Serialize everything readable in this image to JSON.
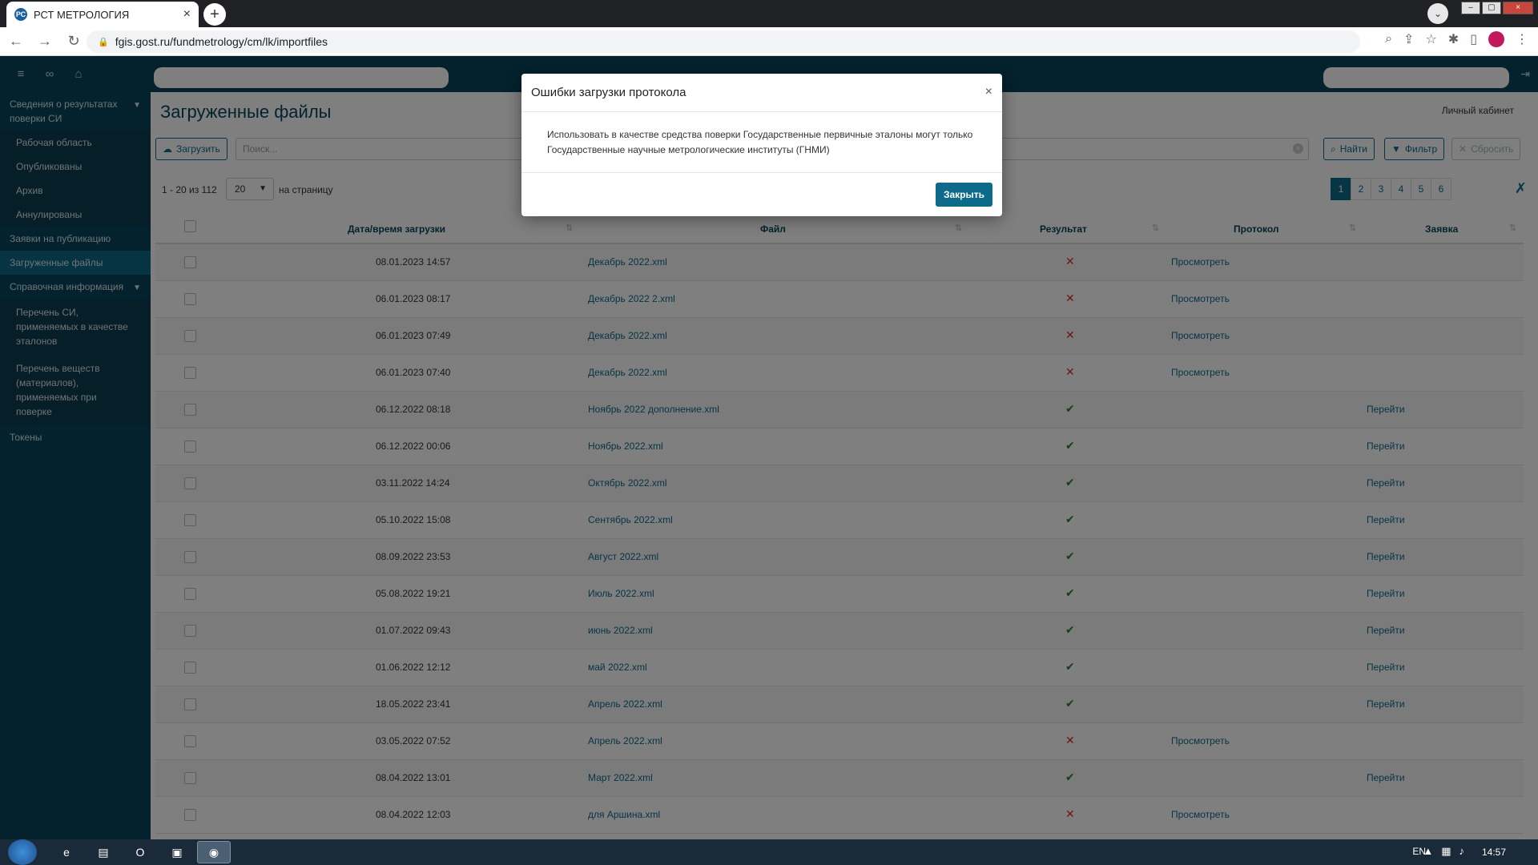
{
  "browser": {
    "tab_title": "РСТ МЕТРОЛОГИЯ",
    "url": "fgis.gost.ru/fundmetrology/cm/lk/importfiles"
  },
  "sidebar": {
    "sections": [
      {
        "label": "Сведения о результатах поверки СИ",
        "items": [
          "Рабочая область",
          "Опубликованы",
          "Архив",
          "Аннулированы"
        ]
      },
      {
        "label": "Заявки на публикацию"
      },
      {
        "label": "Загруженные файлы"
      },
      {
        "label": "Справочная информация",
        "items": [
          "Перечень СИ, применяемых в качестве эталонов",
          "Перечень веществ (материалов), применяемых при поверке"
        ]
      },
      {
        "label": "Токены"
      }
    ]
  },
  "main": {
    "title": "Загруженные файлы",
    "cabinet": "Личный кабинет",
    "upload_label": "Загрузить",
    "search_placeholder": "Поиск...",
    "find_label": "Найти",
    "filter_label": "Фильтр",
    "reset_label": "Сбросить",
    "range_text": "1 - 20 из 112",
    "per_page_value": "20",
    "per_page_label": "на страницу",
    "pages": [
      "1",
      "2",
      "3",
      "4",
      "5",
      "6"
    ]
  },
  "table": {
    "headers": {
      "date": "Дата/время загрузки",
      "file": "Файл",
      "result": "Результат",
      "protocol": "Протокол",
      "application": "Заявка"
    },
    "rows": [
      {
        "date": "08.01.2023 14:57",
        "file": "Декабрь 2022.xml",
        "ok": false,
        "protocol": "Просмотреть",
        "app": ""
      },
      {
        "date": "06.01.2023 08:17",
        "file": "Декабрь 2022 2.xml",
        "ok": false,
        "protocol": "Просмотреть",
        "app": ""
      },
      {
        "date": "06.01.2023 07:49",
        "file": "Декабрь 2022.xml",
        "ok": false,
        "protocol": "Просмотреть",
        "app": ""
      },
      {
        "date": "06.01.2023 07:40",
        "file": "Декабрь 2022.xml",
        "ok": false,
        "protocol": "Просмотреть",
        "app": ""
      },
      {
        "date": "06.12.2022 08:18",
        "file": "Ноябрь 2022 дополнение.xml",
        "ok": true,
        "protocol": "",
        "app": "Перейти"
      },
      {
        "date": "06.12.2022 00:06",
        "file": "Ноябрь 2022.xml",
        "ok": true,
        "protocol": "",
        "app": "Перейти"
      },
      {
        "date": "03.11.2022 14:24",
        "file": "Октябрь 2022.xml",
        "ok": true,
        "protocol": "",
        "app": "Перейти"
      },
      {
        "date": "05.10.2022 15:08",
        "file": "Сентябрь 2022.xml",
        "ok": true,
        "protocol": "",
        "app": "Перейти"
      },
      {
        "date": "08.09.2022 23:53",
        "file": "Август 2022.xml",
        "ok": true,
        "protocol": "",
        "app": "Перейти"
      },
      {
        "date": "05.08.2022 19:21",
        "file": "Июль 2022.xml",
        "ok": true,
        "protocol": "",
        "app": "Перейти"
      },
      {
        "date": "01.07.2022 09:43",
        "file": "июнь 2022.xml",
        "ok": true,
        "protocol": "",
        "app": "Перейти"
      },
      {
        "date": "01.06.2022 12:12",
        "file": "май 2022.xml",
        "ok": true,
        "protocol": "",
        "app": "Перейти"
      },
      {
        "date": "18.05.2022 23:41",
        "file": "Апрель 2022.xml",
        "ok": true,
        "protocol": "",
        "app": "Перейти"
      },
      {
        "date": "03.05.2022 07:52",
        "file": "Апрель 2022.xml",
        "ok": false,
        "protocol": "Просмотреть",
        "app": ""
      },
      {
        "date": "08.04.2022 13:01",
        "file": "Март 2022.xml",
        "ok": true,
        "protocol": "",
        "app": "Перейти"
      },
      {
        "date": "08.04.2022 12:03",
        "file": "для Аршина.xml",
        "ok": false,
        "protocol": "Просмотреть",
        "app": ""
      }
    ]
  },
  "modal": {
    "title": "Ошибки загрузки протокола",
    "message": "Использовать в качестве средства поверки Государственные первичные эталоны могут только Государственные научные метрологические институты (ГНМИ)",
    "close_label": "Закрыть"
  },
  "taskbar": {
    "lang": "EN",
    "time": "14:57"
  },
  "icons": {
    "fail": "✕",
    "ok": "✔"
  },
  "colors": {
    "header": "#06455a",
    "accent": "#0d6a8a",
    "fail": "#d32f2f",
    "ok": "#2e7d32"
  }
}
